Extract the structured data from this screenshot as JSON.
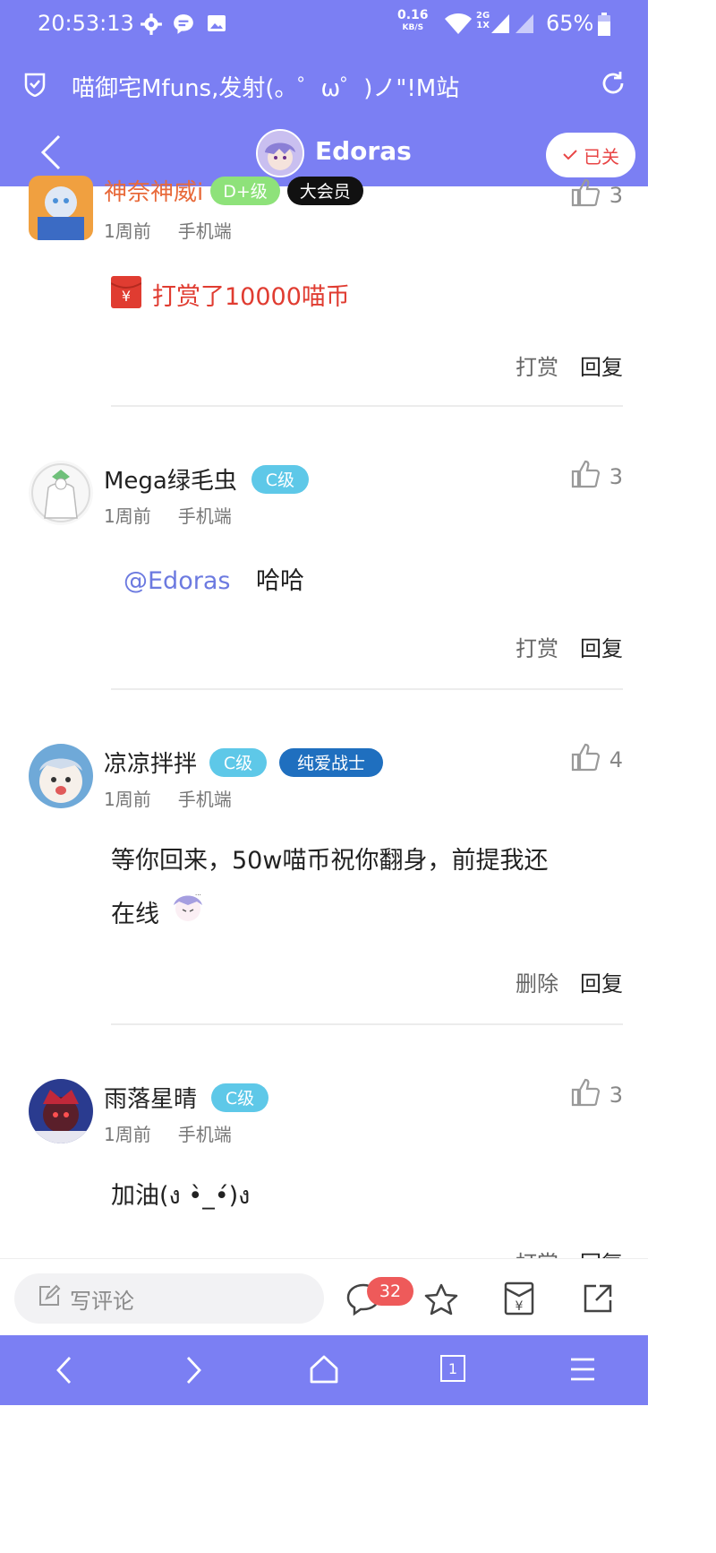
{
  "status_bar": {
    "time": "20:53:13",
    "net_speed": "0.16",
    "net_unit": "KB/S",
    "net_type_top": "2G",
    "net_type_bottom": "1X",
    "battery": "65%"
  },
  "browser": {
    "page_title": "喵御宅Mfuns,发射(。゜ω゜)ノ\"!M站"
  },
  "header": {
    "username": "Edoras",
    "follow_label": "已关"
  },
  "comments": [
    {
      "username": "神奈神威i",
      "badges": [
        "D+级",
        "大会员"
      ],
      "time": "1周前",
      "client": "手机端",
      "likes": "3",
      "reward_text": "打赏了10000喵币",
      "actions": [
        "打赏",
        "回复"
      ]
    },
    {
      "username": "Mega绿毛虫",
      "badges": [
        "C级"
      ],
      "time": "1周前",
      "client": "手机端",
      "likes": "3",
      "mention": "@Edoras",
      "text": "哈哈",
      "actions": [
        "打赏",
        "回复"
      ]
    },
    {
      "username": "凉凉拌拌",
      "badges": [
        "C级",
        "纯爱战士"
      ],
      "time": "1周前",
      "client": "手机端",
      "likes": "4",
      "text_line1": "等你回来，50w喵币祝你翻身，前提我还",
      "text_line2": "在线",
      "actions": [
        "删除",
        "回复"
      ]
    },
    {
      "username": "雨落星晴",
      "badges": [
        "C级"
      ],
      "time": "1周前",
      "client": "手机端",
      "likes": "3",
      "text": "加油(ง •̀_•́)ง",
      "actions": [
        "打赏",
        "回复"
      ]
    }
  ],
  "comment_bar": {
    "placeholder": "写评论",
    "comment_count": "32"
  },
  "nav": {
    "tab_count": "1"
  },
  "colors": {
    "accent": "#7b7ff3",
    "badge_c": "#5ec8e8",
    "badge_d": "#8ee27a",
    "badge_vip": "#111111",
    "badge_love": "#1f6fbf",
    "reward_red": "#e03c31",
    "mention": "#6c7ae0"
  }
}
